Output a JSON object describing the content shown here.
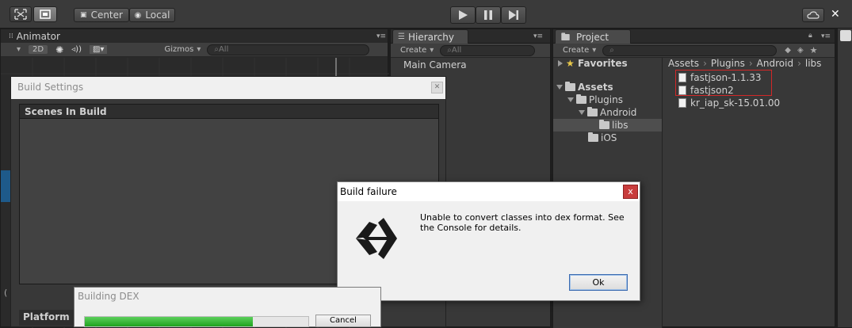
{
  "toolbar": {
    "pivot_label": "Center",
    "space_label": "Local",
    "tools": [
      "move-icon",
      "rect-icon"
    ],
    "play_controls": [
      "play-icon",
      "pause-icon",
      "step-icon"
    ]
  },
  "animator": {
    "tab_label": "Animator",
    "mode_2d": "2D",
    "gizmos_label": "Gizmos",
    "search_placeholder": "All"
  },
  "hierarchy": {
    "tab_label": "Hierarchy",
    "create_label": "Create",
    "search_placeholder": "All",
    "items": [
      "Main Camera"
    ]
  },
  "project": {
    "tab_label": "Project",
    "create_label": "Create",
    "favorites_label": "Favorites",
    "tree": [
      {
        "label": "Assets",
        "level": 0
      },
      {
        "label": "Plugins",
        "level": 1
      },
      {
        "label": "Android",
        "level": 2
      },
      {
        "label": "libs",
        "level": 3,
        "selected": true
      },
      {
        "label": "iOS",
        "level": 2
      }
    ],
    "breadcrumb": [
      "Assets",
      "Plugins",
      "Android",
      "libs"
    ],
    "files": [
      "fastjson-1.1.33",
      "fastjson2",
      "kr_iap_sk-15.01.00"
    ],
    "highlight_color": "#d22828"
  },
  "build_settings": {
    "title": "Build Settings",
    "scenes_header": "Scenes In Build",
    "platform_label": "Platform"
  },
  "dialog": {
    "title": "Build failure",
    "message": "Unable to convert classes into dex format. See the Console for details.",
    "ok_label": "Ok",
    "close_label": "x"
  },
  "building_dex": {
    "title": "Building DEX",
    "progress": 0.75,
    "cancel_label": "Cancel",
    "progress_color": "#2db52d"
  }
}
